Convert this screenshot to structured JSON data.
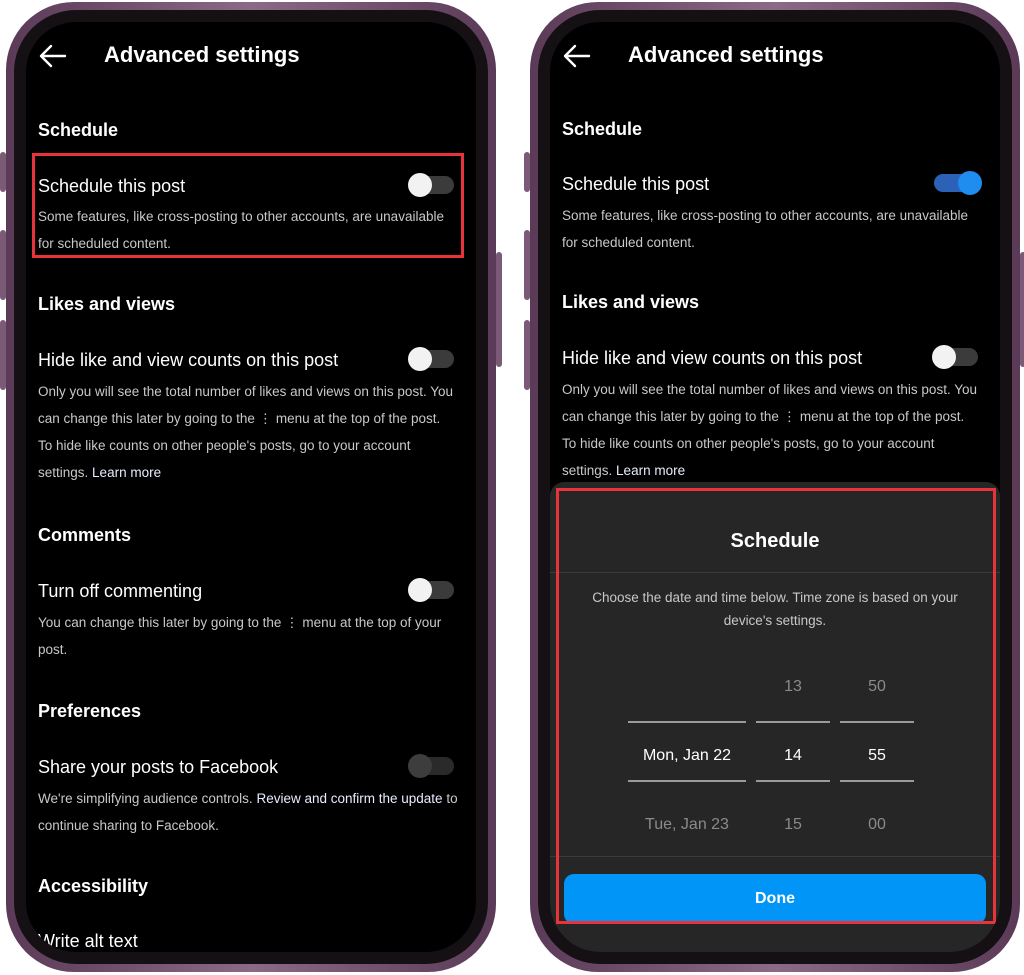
{
  "left": {
    "title": "Advanced settings",
    "schedule_section": "Schedule",
    "schedule_label": "Schedule this post",
    "schedule_desc": "Some features, like cross-posting to other accounts, are unavailable for scheduled content.",
    "likes_section": "Likes and views",
    "hide_likes_label": "Hide like and view counts on this post",
    "hide_likes_desc": "Only you will see the total number of likes and views on this post. You can change this later by going to the ⋮ menu at the top of the post. To hide like counts on other people's posts, go to your account settings.",
    "learn_more": "Learn more",
    "comments_section": "Comments",
    "comments_label": "Turn off commenting",
    "comments_desc": "You can change this later by going to the ⋮ menu at the top of your post.",
    "preferences_section": "Preferences",
    "facebook_label": "Share your posts to Facebook",
    "facebook_desc_prefix": "We're simplifying audience controls.",
    "facebook_desc_link": "Review and confirm the update",
    "facebook_desc_suffix": "to continue sharing to Facebook.",
    "accessibility_section": "Accessibility",
    "alt_text_label": "Write alt text"
  },
  "right": {
    "title": "Advanced settings",
    "schedule_section": "Schedule",
    "schedule_label": "Schedule this post",
    "schedule_desc": "Some features, like cross-posting to other accounts, are unavailable for scheduled content.",
    "likes_section": "Likes and views",
    "hide_likes_label": "Hide like and view counts on this post",
    "hide_likes_desc": "Only you will see the total number of likes and views on this post. You can change this later by going to the ⋮ menu at the top of the post. To hide like counts on other people's posts, go to your account settings.",
    "learn_more": "Learn more",
    "sheet": {
      "title": "Schedule",
      "desc": "Choose the date and time below. Time zone is based on your device's settings.",
      "hour_prev": "13",
      "minute_prev": "50",
      "date_selected": "Mon, Jan 22",
      "hour_selected": "14",
      "minute_selected": "55",
      "date_next": "Tue, Jan 23",
      "hour_next": "15",
      "minute_next": "00",
      "done_label": "Done"
    }
  },
  "toggles": {
    "left_schedule": "off",
    "left_hide_likes": "off",
    "left_comments": "off",
    "left_facebook": "disabled",
    "right_schedule": "on",
    "right_hide_likes": "off"
  },
  "colors": {
    "highlight": "#e8333a",
    "toggle_on": "#1f8cf0",
    "done_button": "#0095f6",
    "phone_frame": "#5a3a56"
  },
  "icons": {
    "back": "arrow-left-icon"
  }
}
